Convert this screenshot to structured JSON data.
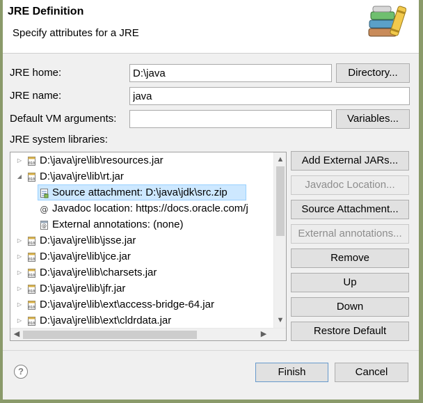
{
  "header": {
    "title": "JRE Definition",
    "subtitle": "Specify attributes for a JRE"
  },
  "form": {
    "jre_home_label": "JRE home:",
    "jre_home_value": "D:\\java",
    "directory_button": "Directory...",
    "jre_name_label": "JRE name:",
    "jre_name_value": "java",
    "vm_args_label": "Default VM arguments:",
    "vm_args_value": "",
    "variables_button": "Variables...",
    "libraries_label": "JRE system libraries:"
  },
  "tree": {
    "rows": [
      {
        "text": "D:\\java\\jre\\lib\\resources.jar",
        "level": 0,
        "twisty": "collapsed",
        "icon": "jar-icon"
      },
      {
        "text": "D:\\java\\jre\\lib\\rt.jar",
        "level": 0,
        "twisty": "expanded",
        "icon": "jar-icon"
      },
      {
        "text": "Source attachment: D:\\java\\jdk\\src.zip",
        "level": 1,
        "twisty": "none",
        "icon": "source-attachment-icon",
        "selected": true
      },
      {
        "text": "Javadoc location: https://docs.oracle.com/j",
        "level": 1,
        "twisty": "none",
        "icon": "javadoc-at-icon"
      },
      {
        "text": "External annotations: (none)",
        "level": 1,
        "twisty": "none",
        "icon": "external-annotations-icon"
      },
      {
        "text": "D:\\java\\jre\\lib\\jsse.jar",
        "level": 0,
        "twisty": "collapsed",
        "icon": "jar-icon"
      },
      {
        "text": "D:\\java\\jre\\lib\\jce.jar",
        "level": 0,
        "twisty": "collapsed",
        "icon": "jar-icon"
      },
      {
        "text": "D:\\java\\jre\\lib\\charsets.jar",
        "level": 0,
        "twisty": "collapsed",
        "icon": "jar-icon"
      },
      {
        "text": "D:\\java\\jre\\lib\\jfr.jar",
        "level": 0,
        "twisty": "collapsed",
        "icon": "jar-icon"
      },
      {
        "text": "D:\\java\\jre\\lib\\ext\\access-bridge-64.jar",
        "level": 0,
        "twisty": "collapsed",
        "icon": "jar-icon"
      },
      {
        "text": "D:\\java\\jre\\lib\\ext\\cldrdata.jar",
        "level": 0,
        "twisty": "collapsed",
        "icon": "jar-icon"
      }
    ]
  },
  "side_buttons": {
    "add_external_jars": "Add External JARs...",
    "javadoc_location": "Javadoc Location...",
    "source_attachment": "Source Attachment...",
    "external_annotations": "External annotations...",
    "remove": "Remove",
    "up": "Up",
    "down": "Down",
    "restore_default": "Restore Default"
  },
  "footer": {
    "help_glyph": "?",
    "finish": "Finish",
    "cancel": "Cancel"
  },
  "colors": {
    "selection_bg": "#cde8ff",
    "selection_border": "#99d1ff",
    "dialog_bg": "#f0f0f0",
    "window_border": "#8a9a6a"
  }
}
